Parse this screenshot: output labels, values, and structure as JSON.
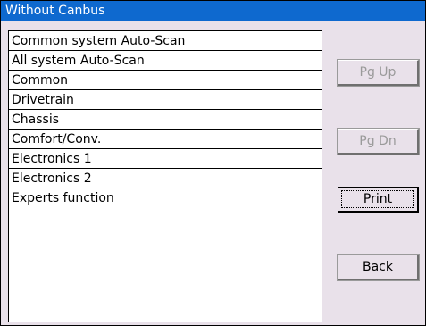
{
  "window": {
    "title": "Without Canbus"
  },
  "menu": {
    "items": [
      {
        "label": "Common system Auto-Scan"
      },
      {
        "label": "All system Auto-Scan"
      },
      {
        "label": "Common"
      },
      {
        "label": "Drivetrain"
      },
      {
        "label": "Chassis"
      },
      {
        "label": "Comfort/Conv."
      },
      {
        "label": "Electronics 1"
      },
      {
        "label": "Electronics 2"
      },
      {
        "label": "Experts function"
      }
    ]
  },
  "buttons": {
    "pg_up": "Pg Up",
    "pg_dn": "Pg Dn",
    "print": "Print",
    "back": "Back"
  },
  "colors": {
    "titlebar": "#0e69cf",
    "window_bg": "#e9e1ea",
    "disabled_text": "#9a9a9a"
  }
}
